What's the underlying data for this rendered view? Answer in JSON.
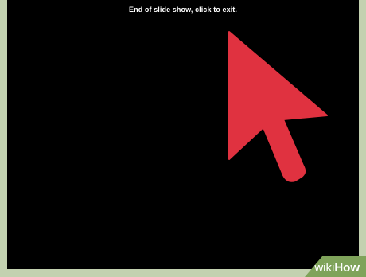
{
  "slideshow": {
    "end_message": "End of slide show, click to exit.",
    "cursor_icon": "mouse-pointer-arrow-icon",
    "cursor_color": "#e03240",
    "background_color": "#000000",
    "frame_color": "#c3d1b0"
  },
  "watermark": {
    "part1": "wiki",
    "part2": "How",
    "color": "#7fa35a"
  }
}
